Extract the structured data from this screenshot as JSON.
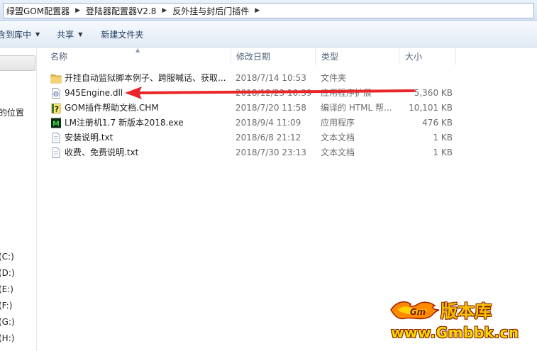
{
  "breadcrumb": [
    "绿盟GOM配置器",
    "登陆器配置器V2.8",
    "反外挂与封后门插件"
  ],
  "toolbar": {
    "include_label": "含到库中",
    "share_label": "共享",
    "new_folder_label": "新建文件夹"
  },
  "nav": {
    "item_location": "的位置",
    "drives": [
      "(C:)",
      "(D:)",
      "(E:)",
      "(F:)",
      "(G:)",
      "(H:)"
    ]
  },
  "columns": {
    "name": "名称",
    "date": "修改日期",
    "type": "类型",
    "size": "大小"
  },
  "files": [
    {
      "icon": "folder-icon",
      "name": "开挂自动监狱脚本例子、跨服喊话、获取...",
      "date": "2018/7/14 10:53",
      "type": "文件夹",
      "size": ""
    },
    {
      "icon": "dll-icon",
      "name": "945Engine.dll",
      "date": "2018/12/23 10:39",
      "type": "应用程序扩展",
      "size": "5,360 KB"
    },
    {
      "icon": "chm-help-icon",
      "name": "GOM插件帮助文档.CHM",
      "date": "2018/7/20 11:58",
      "type": "编译的 HTML 帮...",
      "size": "10,101 KB"
    },
    {
      "icon": "exe-app-icon",
      "name": "LM注册机1.7 新版本2018.exe",
      "date": "2018/9/4 11:09",
      "type": "应用程序",
      "size": "476 KB"
    },
    {
      "icon": "txt-file-icon",
      "name": "安装说明.txt",
      "date": "2018/6/8 21:12",
      "type": "文本文档",
      "size": "1 KB"
    },
    {
      "icon": "txt-file-icon",
      "name": "收费、免费说明.txt",
      "date": "2018/7/30 23:13",
      "type": "文本文档",
      "size": "1 KB"
    }
  ],
  "watermark": {
    "brand": "版本库",
    "url": "www.Gmbbk.cn"
  },
  "colors": {
    "arrow": "#e8262a",
    "watermark_yellow": "#f5c400",
    "header_text": "#4c607a"
  }
}
